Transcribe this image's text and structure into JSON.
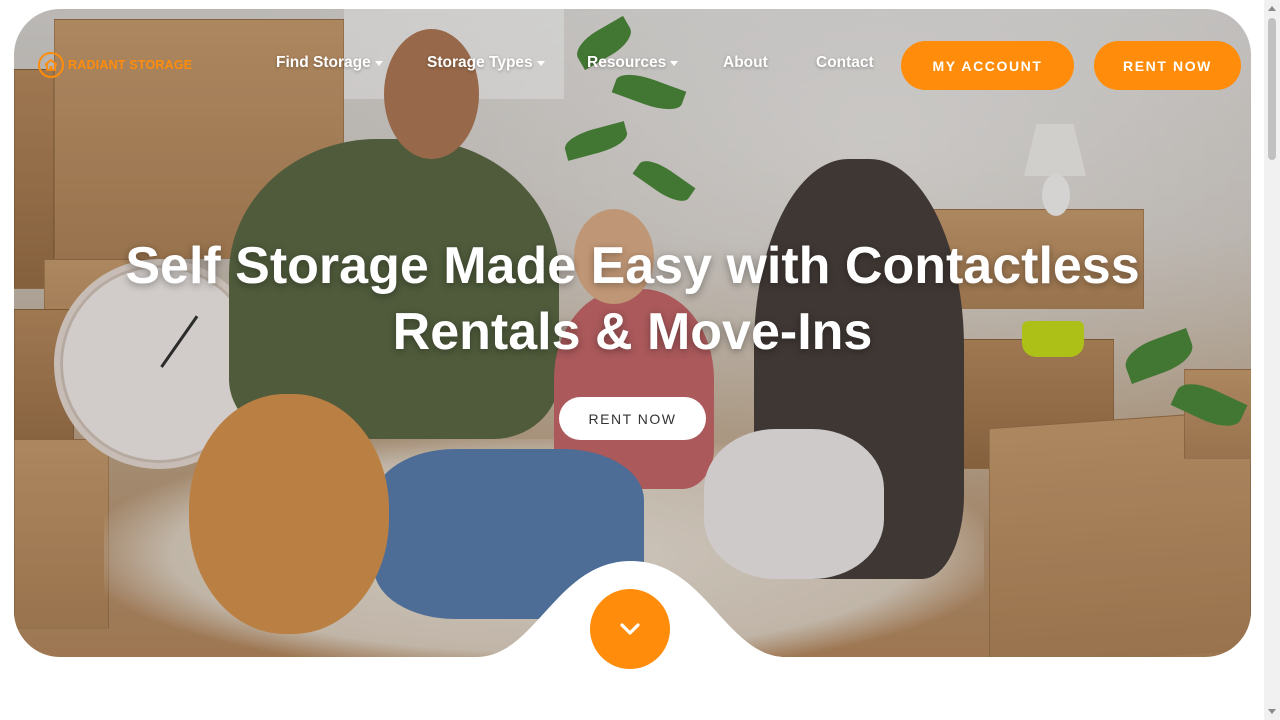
{
  "brand": {
    "name": "RADIANT STORAGE",
    "accent_color": "#ff8c0a",
    "logo_icon": "house-circle-icon"
  },
  "nav": {
    "items": [
      {
        "label": "Find Storage",
        "has_dropdown": true
      },
      {
        "label": "Storage Types",
        "has_dropdown": true
      },
      {
        "label": "Resources",
        "has_dropdown": true
      },
      {
        "label": "About",
        "has_dropdown": false
      },
      {
        "label": "Contact",
        "has_dropdown": false
      }
    ],
    "my_account_label": "MY ACCOUNT",
    "rent_now_label": "RENT NOW"
  },
  "hero": {
    "headline_line1": "Self Storage Made Easy with Contactless",
    "headline_line2": "Rentals & Move-Ins",
    "cta_label": "RENT NOW",
    "image_subject": "family with dog among moving boxes",
    "scroll_icon": "chevron-down-icon"
  }
}
